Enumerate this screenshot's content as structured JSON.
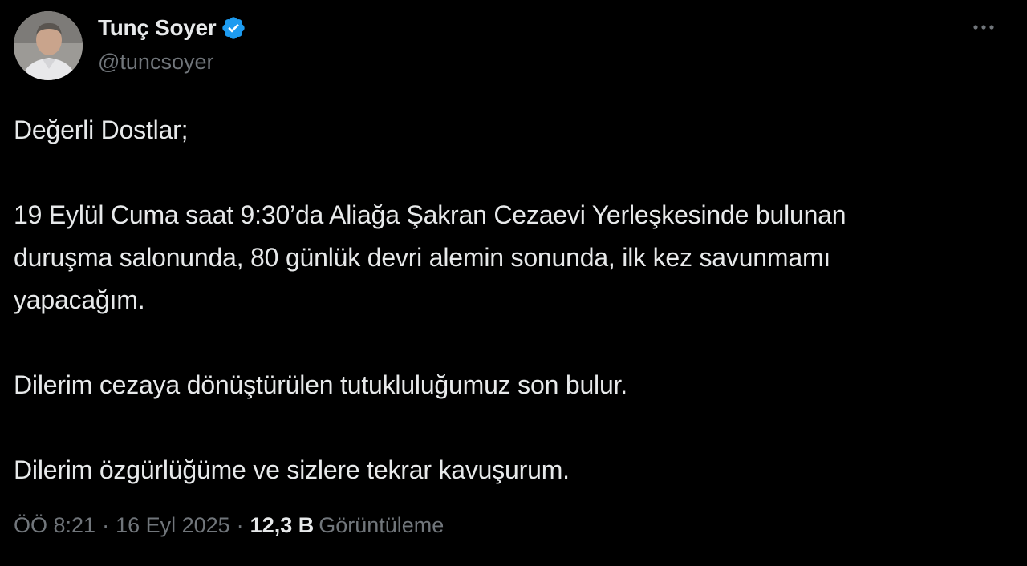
{
  "author": {
    "display_name": "Tunç Soyer",
    "handle": "@tuncsoyer",
    "verified": true
  },
  "tweet": {
    "paragraphs": [
      "Değerli Dostlar;",
      "19 Eylül Cuma saat 9:30’da Aliağa Şakran Cezaevi Yerleşkesinde bulunan\nduruşma salonunda, 80 günlük devri alemin sonunda, ilk kez savunmamı\nyapacağım.",
      "Dilerim cezaya dönüştürülen tutukluluğumuz son bulur.",
      "Dilerim özgürlüğüme ve sizlere tekrar kavuşurum."
    ]
  },
  "meta": {
    "time": "ÖÖ 8:21",
    "separator": "·",
    "date": "16 Eyl 2025",
    "views_count": "12,3 B",
    "views_label": "Görüntüleme"
  },
  "icons": {
    "verified": "verified-badge-icon",
    "more": "more-options-icon"
  },
  "colors": {
    "background": "#000000",
    "text_primary": "#e7e9ea",
    "text_secondary": "#71767b",
    "verified_blue": "#1d9bf0"
  }
}
